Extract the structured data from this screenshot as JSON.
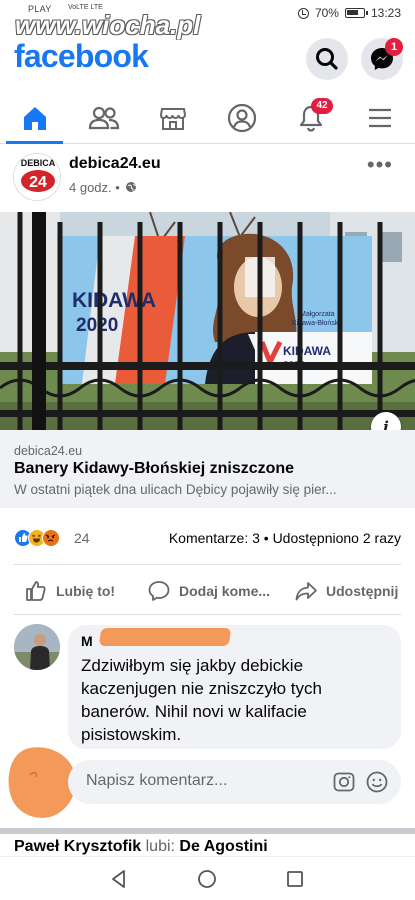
{
  "status_bar": {
    "carrier": "PLAY",
    "carrier_sub": "VoLTE LTE",
    "battery": "70%",
    "time": "13:23"
  },
  "watermark": "www.wiocha.pl",
  "header": {
    "logo": "facebook",
    "search_icon": "search-icon",
    "messenger_icon": "messenger-icon",
    "messenger_badge": "1"
  },
  "nav": {
    "items": [
      "home-icon",
      "friends-icon",
      "marketplace-icon",
      "profile-icon",
      "notifications-icon",
      "menu-icon"
    ],
    "notifications_badge": "42",
    "active_color": "#1877f2"
  },
  "post": {
    "page_name": "debica24.eu",
    "page_logo_text": "DEBICA",
    "page_logo_number": "24",
    "time": "4 godz. •",
    "banner_text_1": "KIDAWA",
    "banner_text_2": "2020",
    "banner_name_1": "Małgorzata",
    "banner_name_2": "Kidawa-Błońska",
    "banner_logo_1": "KIDAWA",
    "banner_logo_2": "2020",
    "link": {
      "domain": "debica24.eu",
      "title": "Banery Kidawy-Błońskiej zniszczone",
      "description": "W ostatni piątek dna ulicach Dębicy pojawiły się pier..."
    },
    "reactions": {
      "count": "24",
      "stats": "Komentarze: 3 • Udostępniono 2 razy"
    },
    "actions": {
      "like": "Lubię to!",
      "comment": "Dodaj kome...",
      "share": "Udostępnij"
    }
  },
  "comment": {
    "name": "M",
    "text": "Zdziwiłbym się jakby debickie kaczenjugen nie zniszczyło tych banerów. Nihil novi w kalifacie pisistowskim."
  },
  "write_comment": {
    "placeholder": "Napisz komentarz..."
  },
  "next_story": {
    "actor": "Paweł Krysztofik",
    "verb": "lubi:",
    "target": "De Agostini"
  },
  "colors": {
    "brand": "#1877f2",
    "badge": "#e41e3f",
    "redaction": "#f39a5a"
  }
}
